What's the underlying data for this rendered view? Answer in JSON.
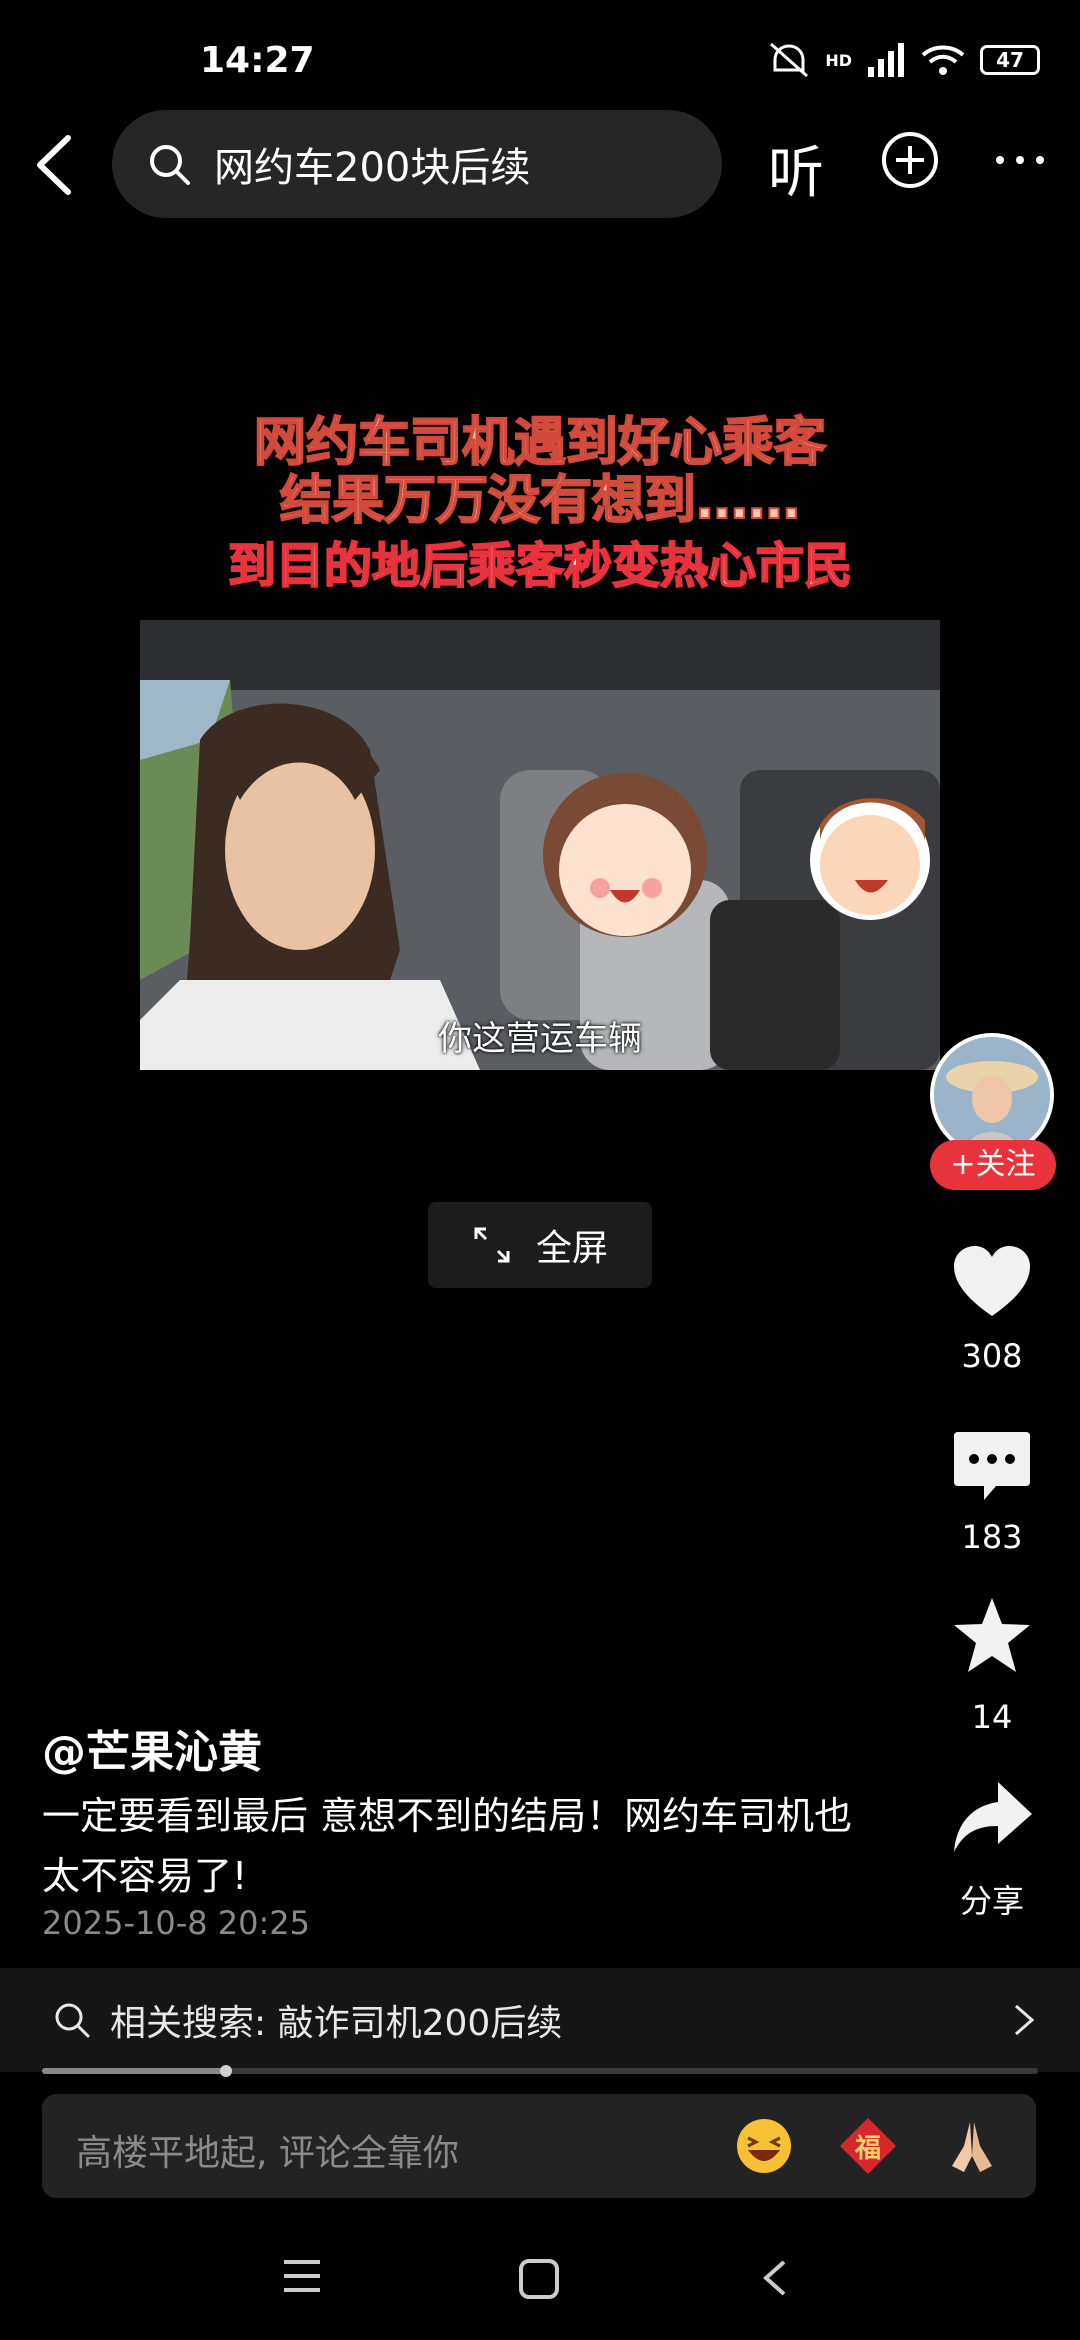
{
  "status_bar": {
    "time": "14:27",
    "network_label": "HD",
    "battery": "47"
  },
  "top_bar": {
    "search_text": "网约车200块后续",
    "listen_label": "听"
  },
  "video": {
    "caption_line1": "网约车司机遇到好心乘客",
    "caption_line2": "结果万万没有想到……",
    "caption_line3": "到目的地后乘客秒变热心市民",
    "subtitle": "你这营运车辆",
    "fullscreen_label": "全屏"
  },
  "right_rail": {
    "follow_label": "+关注",
    "likes": "308",
    "comments": "183",
    "favorites": "14",
    "share_label": "分享"
  },
  "post": {
    "author": "@芒果沁黄",
    "description": "一定要看到最后 意想不到的结局！网约车司机也太不容易了!",
    "date": "2025-10-8 20:25"
  },
  "related_search": {
    "text": "相关搜索: 敲诈司机200后续"
  },
  "playback": {
    "progress": 0.185
  },
  "comment_box": {
    "placeholder": "高楼平地起, 评论全靠你",
    "emoji_fu": "福"
  },
  "colors": {
    "accent": "#e8333c",
    "background": "#000000"
  }
}
